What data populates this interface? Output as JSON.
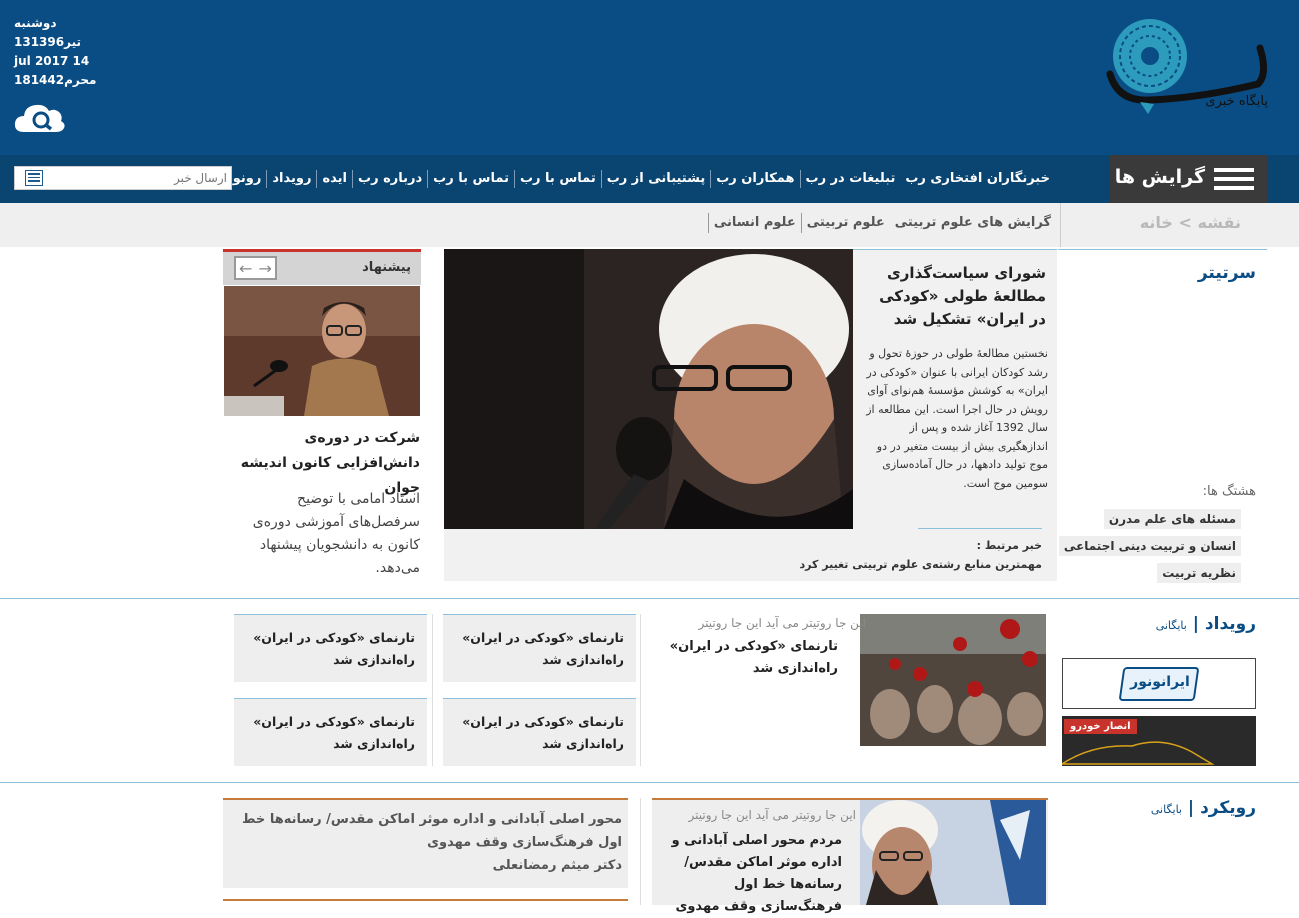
{
  "header": {
    "dates": [
      "دوشنبه",
      "13تیر1396",
      "jul 2017 14",
      "18محرم1442"
    ],
    "logo_caption": "پایگاه خبری"
  },
  "nav": {
    "menu_label": "گرایش ها",
    "links": [
      "رونوشت",
      "رویداد",
      "ایده",
      "درباره رب",
      "تماس با رب",
      "تماس با رب",
      "پشتیبانی از رب",
      "همکاران رب",
      "تبلیغات در رب",
      "خبرنگاران افتخاری رب"
    ],
    "send_placeholder": "ارسال خبر"
  },
  "breadcrumb": {
    "text": "نقشه > خانه",
    "tags": [
      "علوم انسانی",
      "علوم تربیتی",
      "گرایش های علوم تربیتی"
    ]
  },
  "sartitr": {
    "title": "سرتیتر",
    "hashtag_label": "هشتگ ها:",
    "hashtags": [
      "مسئله های علم مدرن",
      "انسان و تربیت دینی اجتماعی",
      "نظریه تربیت"
    ],
    "main_title": "شورای سیاست‌گذاری مطالعهٔ طولی «کودکی در ایران» تشکیل شد",
    "main_body": "نخستین مطالعهٔ طولی در حوزهٔ تحول و رشد کودکان ایرانی با عنوان «کودکی در ایران» به کوشش مؤسسهٔ هم‌نوای آوای رویش در حال اجرا است. این مطالعه از سال 1392 آغاز شده و پس از اندازهگیری بیش از بیست متغیر در دو موج تولید دادهها، در حال آماده‌سازی سومین موج است.",
    "related_label": "خبر مرتبط :",
    "related_link": "مهمترین منابع رشته‌ی علوم تربیتی تغییر کرد"
  },
  "suggestion": {
    "title": "پیشنهاد",
    "story_title": "شرکت در دوره‌ی دانش‌افزایی کانون اندیشه جوان",
    "story_body": "استاد امامی با توضیح سرفصل‌های آموزشی دوره‌ی کانون به دانشجویان پیشنهاد می‌دهد."
  },
  "events": {
    "title": "رویداد",
    "archive": "بایگانی",
    "rumor": "این جا روتیتر می آید این جا روتیتر",
    "main_title": "تارنمای «کودکی در ایران» راه‌اندازی شد",
    "cards": [
      "تارنمای «کودکی در ایران» راه‌اندازی شد",
      "تارنمای «کودکی در ایران» راه‌اندازی شد",
      "تارنمای «کودکی در ایران» راه‌اندازی شد",
      "تارنمای «کودکی در ایران» راه‌اندازی شد"
    ],
    "ad1_text": "ایرانونور",
    "ad2_text": "انصار خودرو"
  },
  "approach": {
    "title": "رویکرد",
    "archive": "بایگانی",
    "rumor": "این جا روتیتر می آید این جا روتیتر",
    "main_title": "مردم محور اصلی آبادانی و اداره موثر اماکن مقدس/ رسانه‌ها خط اول فرهنگ‌سازی وقف مهدوی",
    "left_title": "محور اصلی آبادانی و اداره موثر اماکن مقدس/ رسانه‌ها خط اول فرهنگ‌سازی وقف مهدوی",
    "left_author": "دکتر میثم رمضانعلی"
  },
  "colors": {
    "header": "#0a4d85",
    "nav": "#0a4471",
    "accent": "#c8332b"
  }
}
